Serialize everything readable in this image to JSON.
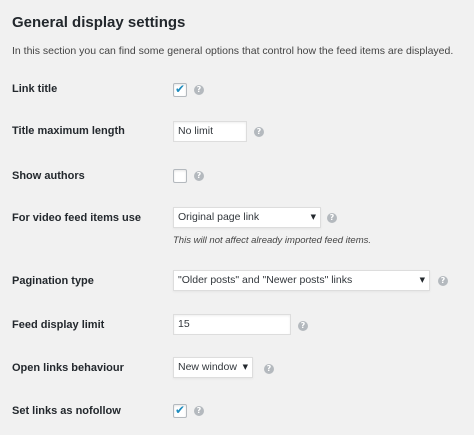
{
  "section": {
    "title": "General display settings",
    "description": "In this section you can find some general options that control how the feed items are displayed."
  },
  "help_icon": "question-mark-circle-icon",
  "settings": {
    "link_title": {
      "label": "Link title",
      "checked": true,
      "check_glyph": "✔"
    },
    "title_max_length": {
      "label": "Title maximum length",
      "value": "No limit"
    },
    "show_authors": {
      "label": "Show authors",
      "checked": false
    },
    "video_feed_items": {
      "label": "For video feed items use",
      "selected": "Original page link",
      "note": "This will not affect already imported feed items."
    },
    "pagination_type": {
      "label": "Pagination type",
      "selected": "\"Older posts\" and \"Newer posts\" links"
    },
    "feed_display_limit": {
      "label": "Feed display limit",
      "value": "15"
    },
    "open_links": {
      "label": "Open links behaviour",
      "selected": "New window"
    },
    "nofollow": {
      "label": "Set links as nofollow",
      "checked": true,
      "check_glyph": "✔"
    }
  },
  "glyphs": {
    "help": "?",
    "dropdown_arrow": "▼"
  },
  "colors": {
    "background": "#f1f1f1",
    "check_accent": "#1e8cbe",
    "help_icon": "#b4b9be"
  }
}
